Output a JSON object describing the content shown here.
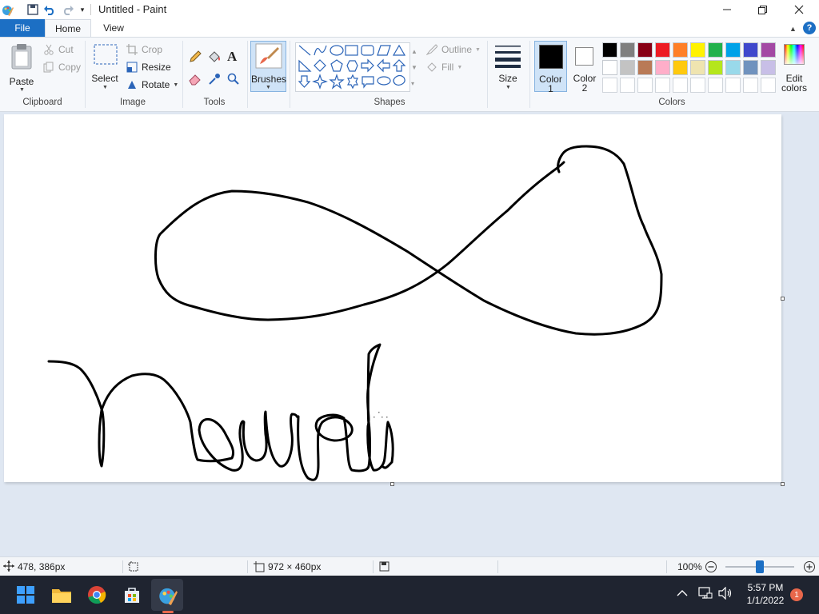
{
  "window": {
    "title": "Untitled - Paint",
    "controls": {
      "minimize": "minimize-icon",
      "maximize": "maximize-icon",
      "close": "close-icon"
    }
  },
  "tabs": [
    {
      "label": "File",
      "active": false
    },
    {
      "label": "Home",
      "active": true
    },
    {
      "label": "View",
      "active": false
    }
  ],
  "ribbon": {
    "clipboard": {
      "group_label": "Clipboard",
      "paste_label": "Paste",
      "cut_label": "Cut",
      "copy_label": "Copy"
    },
    "image": {
      "group_label": "Image",
      "select_label": "Select",
      "crop_label": "Crop",
      "resize_label": "Resize",
      "rotate_label": "Rotate"
    },
    "tools": {
      "group_label": "Tools",
      "items": [
        "pencil-icon",
        "fill-icon",
        "text-icon",
        "eraser-icon",
        "color-picker-icon",
        "magnifier-icon"
      ]
    },
    "brushes": {
      "label": "Brushes"
    },
    "shapes": {
      "group_label": "Shapes",
      "outline_label": "Outline",
      "fill_label": "Fill"
    },
    "size": {
      "label": "Size"
    },
    "colors": {
      "group_label": "Colors",
      "color1_label": "Color",
      "color1_num": "1",
      "color2_label": "Color",
      "color2_num": "2",
      "color1_value": "#000000",
      "color2_value": "#ffffff",
      "edit_label_1": "Edit",
      "edit_label_2": "colors",
      "palette_row1": [
        "#000000",
        "#7f7f7f",
        "#880015",
        "#ed1c24",
        "#ff7f27",
        "#fff200",
        "#22b14c",
        "#00a2e8",
        "#3f48cc",
        "#a349a4"
      ],
      "palette_row2": [
        "#ffffff",
        "#c3c3c3",
        "#b97a57",
        "#ffaec9",
        "#ffc90e",
        "#efe4b0",
        "#b5e61d",
        "#99d9ea",
        "#7092be",
        "#c8bfe7"
      ]
    }
  },
  "statusbar": {
    "cursor_pos": "478, 386px",
    "canvas_size": "972 × 460px",
    "zoom": "100%",
    "zoom_level": 0.5
  },
  "taskbar": {
    "apps": [
      "start-icon",
      "file-explorer-icon",
      "chrome-icon",
      "store-icon",
      "paint-icon"
    ],
    "time": "5:57 PM",
    "date": "1/1/2022",
    "notification_count": "1"
  }
}
